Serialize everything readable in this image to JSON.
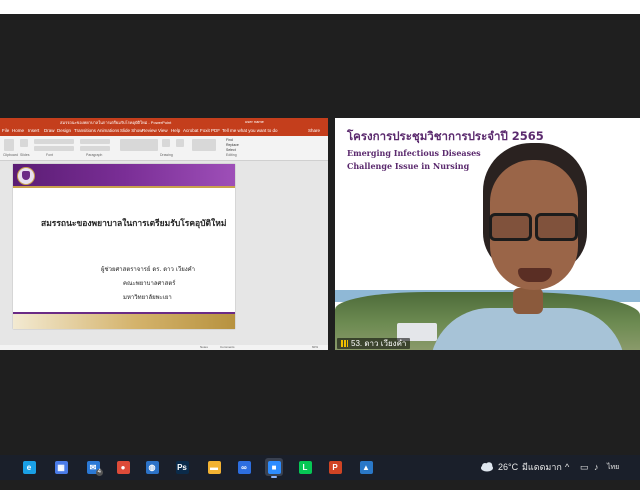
{
  "ppt": {
    "window_title": "สมรรถนะของพยาบาลในการเตรียมรับโรคอุบัติใหม่ - PowerPoint",
    "user_name": "user name",
    "tabs": [
      "File",
      "Home",
      "Insert",
      "Draw",
      "Design",
      "Transitions",
      "Animations",
      "Slide Show",
      "Review",
      "View",
      "Help",
      "Acrobat",
      "Foxit PDF",
      "Tell me what you want to do"
    ],
    "share_label": "Share",
    "ribbon_groups": [
      "Clipboard",
      "Slides",
      "Font",
      "Paragraph",
      "Drawing",
      "Editing"
    ],
    "ribbon_editing": [
      "Find",
      "Replace",
      "Select"
    ],
    "status_notes": "Notes",
    "status_comments": "Comments",
    "zoom": "60%"
  },
  "slide": {
    "title": "สมรรถนะของพยาบาลในการเตรียมรับโรคอุบัติใหม่",
    "lines": [
      "ผู้ช่วยศาสตราจารย์ ดร. ดาว เวียงคำ",
      "คณะพยาบาลศาสตร์",
      "มหาวิทยาลัยพะเยา"
    ],
    "colors": {
      "band": "#6b2b86",
      "gold": "#c9a24d"
    }
  },
  "video": {
    "heading": "โครงการประชุมวิชาการประจำปี 2565",
    "subheading_1": "Emerging Infectious Diseases",
    "subheading_2": "Challenge Issue in Nursing",
    "participant_name": "53. ดาว เวียงคำ"
  },
  "taskbar": {
    "apps": [
      {
        "name": "edge",
        "color": "#1aa0e6",
        "glyph": "e"
      },
      {
        "name": "store",
        "color": "#4a7be8",
        "glyph": "▦"
      },
      {
        "name": "mail",
        "color": "#2b79d6",
        "glyph": "✉",
        "badge": "4"
      },
      {
        "name": "chrome",
        "color": "#dd4b39",
        "glyph": "●"
      },
      {
        "name": "globe",
        "color": "#2c72c7",
        "glyph": "◍"
      },
      {
        "name": "photoshop",
        "color": "#0b2b4a",
        "glyph": "Ps"
      },
      {
        "name": "file-explorer",
        "color": "#f2b233",
        "glyph": "▬"
      },
      {
        "name": "connect",
        "color": "#2d6ee0",
        "glyph": "∞"
      },
      {
        "name": "zoom",
        "color": "#2d8cff",
        "glyph": "■",
        "active": true
      },
      {
        "name": "line",
        "color": "#06c755",
        "glyph": "L"
      },
      {
        "name": "powerpoint",
        "color": "#d04424",
        "glyph": "P"
      },
      {
        "name": "photos",
        "color": "#2a78c8",
        "glyph": "▲"
      }
    ],
    "weather": "26°C",
    "weather_text": "มีแดดมาก",
    "tray_icons": [
      "^",
      "▭",
      "♪",
      "ไทย"
    ]
  }
}
